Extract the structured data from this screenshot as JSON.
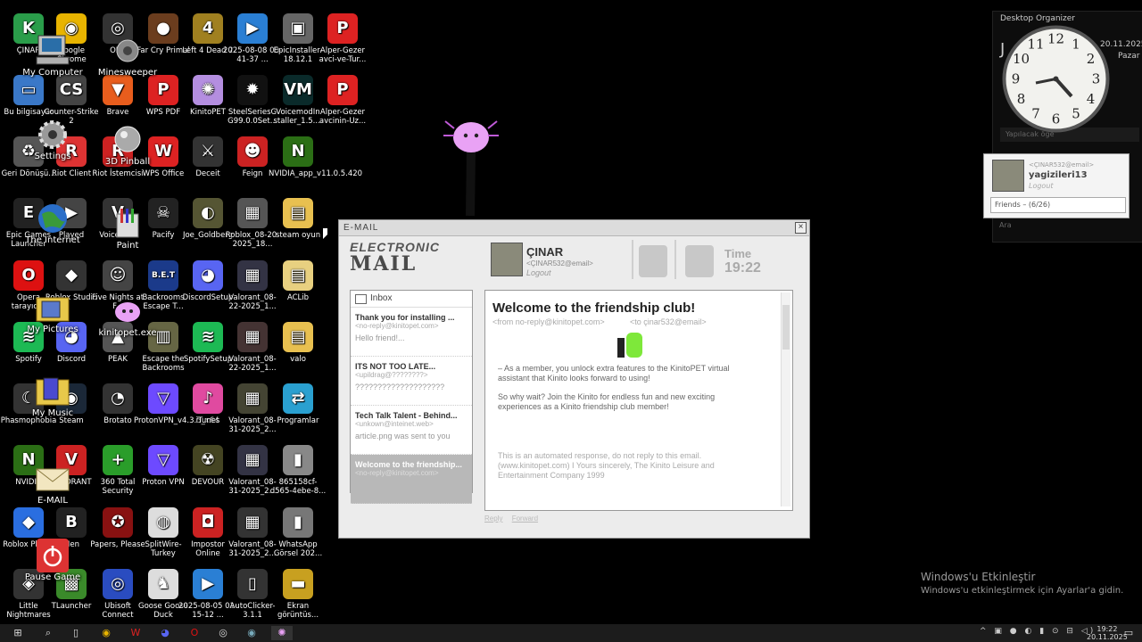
{
  "desktop": {
    "icons": [
      {
        "label": "ÇINAR",
        "glyph": "K",
        "color": "#2a9d4a"
      },
      {
        "label": "Google Chrome",
        "glyph": "◉",
        "color": "#e8b400"
      },
      {
        "label": "OBS",
        "glyph": "◎",
        "color": "#333"
      },
      {
        "label": "Far Cry Primal",
        "glyph": "●",
        "color": "#6b3d1e"
      },
      {
        "label": "Left 4 Dead 2",
        "glyph": "4",
        "color": "#a08020"
      },
      {
        "label": "2025-08-08 00-41-37 ...",
        "glyph": "▶",
        "color": "#2a7fd4"
      },
      {
        "label": "EpicInstaller-18.12.1",
        "glyph": "▣",
        "color": "#666"
      },
      {
        "label": "Alper-Gezer avci-ve-Tur...",
        "glyph": "P",
        "color": "#d22"
      },
      {
        "label": "Bu bilgisayar",
        "glyph": "▭",
        "color": "#3a78c8"
      },
      {
        "label": "Counter-Strike 2",
        "glyph": "CS",
        "color": "#444"
      },
      {
        "label": "Brave",
        "glyph": "▼",
        "color": "#e85d1d"
      },
      {
        "label": "WPS PDF",
        "glyph": "P",
        "color": "#d22"
      },
      {
        "label": "KinitoPET",
        "glyph": "✺",
        "color": "#b48ee0"
      },
      {
        "label": "SteelSeriesG G99.0.0Set...",
        "glyph": "✹",
        "color": "#111"
      },
      {
        "label": "VoicemodIn staller_1.5....",
        "glyph": "VM",
        "color": "#0a2a2a"
      },
      {
        "label": "Alper-Gezer avcinin-Uz...",
        "glyph": "P",
        "color": "#d22"
      },
      {
        "label": "Geri Dönüşü...",
        "glyph": "♻",
        "color": "#555"
      },
      {
        "label": "Riot Client",
        "glyph": "R",
        "color": "#d33"
      },
      {
        "label": "Riot İstemcisi",
        "glyph": "R",
        "color": "#c22"
      },
      {
        "label": "WPS Office",
        "glyph": "W",
        "color": "#d22"
      },
      {
        "label": "Deceit",
        "glyph": "⚔",
        "color": "#333"
      },
      {
        "label": "Feign",
        "glyph": "☻",
        "color": "#c22"
      },
      {
        "label": "NVIDIA_app_v11.0.5.420",
        "glyph": "N",
        "color": "#2b6e15"
      },
      {
        "label": "",
        "glyph": "",
        "color": "#000"
      },
      {
        "label": "Epic Games Launcher",
        "glyph": "E",
        "color": "#222"
      },
      {
        "label": "Played",
        "glyph": "▶",
        "color": "#444"
      },
      {
        "label": "Voicemod",
        "glyph": "V",
        "color": "#333"
      },
      {
        "label": "Pacify",
        "glyph": "☠",
        "color": "#222"
      },
      {
        "label": "Joe_Goldberg",
        "glyph": "◐",
        "color": "#553"
      },
      {
        "label": "Roblox_08-20-2025_18...",
        "glyph": "▦",
        "color": "#555"
      },
      {
        "label": "steam oyun",
        "glyph": "▤",
        "color": "#e8c050"
      },
      {
        "label": "",
        "glyph": "",
        "color": "#000"
      },
      {
        "label": "Opera tarayıcısı",
        "glyph": "O",
        "color": "#d11"
      },
      {
        "label": "Roblox Studio",
        "glyph": "◆",
        "color": "#333"
      },
      {
        "label": "Five Nights at F...",
        "glyph": "☺",
        "color": "#444"
      },
      {
        "label": "Backrooms Escape T...",
        "glyph": "B.E.T",
        "color": "#1b3a8a"
      },
      {
        "label": "DiscordSetup",
        "glyph": "◕",
        "color": "#5865f2"
      },
      {
        "label": "Valorant_08-22-2025_1...",
        "glyph": "▦",
        "color": "#334"
      },
      {
        "label": "ACLib",
        "glyph": "▤",
        "color": "#e8d080"
      },
      {
        "label": "",
        "glyph": "",
        "color": "#000"
      },
      {
        "label": "Spotify",
        "glyph": "≋",
        "color": "#1db954"
      },
      {
        "label": "Discord",
        "glyph": "◕",
        "color": "#5865f2"
      },
      {
        "label": "PEAK",
        "glyph": "▲",
        "color": "#555"
      },
      {
        "label": "Escape the Backrooms",
        "glyph": "▥",
        "color": "#664"
      },
      {
        "label": "SpotifySetup",
        "glyph": "≋",
        "color": "#1db954"
      },
      {
        "label": "Valorant_08-22-2025_1...",
        "glyph": "▦",
        "color": "#433"
      },
      {
        "label": "valo",
        "glyph": "▤",
        "color": "#e8c050"
      },
      {
        "label": "",
        "glyph": "",
        "color": "#000"
      },
      {
        "label": "Phasmophobia",
        "glyph": "☾",
        "color": "#333"
      },
      {
        "label": "Steam",
        "glyph": "◉",
        "color": "#1b2838"
      },
      {
        "label": "Brotato",
        "glyph": "◔",
        "color": "#333"
      },
      {
        "label": "ProtonVPN_v4.3.5_x64",
        "glyph": "▽",
        "color": "#6d4aff"
      },
      {
        "label": "iTunes",
        "glyph": "♪",
        "color": "#e04aa0"
      },
      {
        "label": "Valorant_08-31-2025_2...",
        "glyph": "▦",
        "color": "#443"
      },
      {
        "label": "Programlar",
        "glyph": "⇄",
        "color": "#2aa0d0"
      },
      {
        "label": "",
        "glyph": "",
        "color": "#000"
      },
      {
        "label": "NVIDIA",
        "glyph": "N",
        "color": "#2b6e15"
      },
      {
        "label": "VALORANT",
        "glyph": "V",
        "color": "#c22"
      },
      {
        "label": "360 Total Security",
        "glyph": "+",
        "color": "#2a9d2a"
      },
      {
        "label": "Proton VPN",
        "glyph": "▽",
        "color": "#6d4aff"
      },
      {
        "label": "DEVOUR",
        "glyph": "☢",
        "color": "#442"
      },
      {
        "label": "Valorant_08-31-2025_2...",
        "glyph": "▦",
        "color": "#334"
      },
      {
        "label": "865158cf-d565-4ebe-8...",
        "glyph": "▮",
        "color": "#888"
      },
      {
        "label": "",
        "glyph": "",
        "color": "#000"
      },
      {
        "label": "Roblox Player",
        "glyph": "◆",
        "color": "#2a6ee0"
      },
      {
        "label": "Men",
        "glyph": "B",
        "color": "#222"
      },
      {
        "label": "Papers, Please",
        "glyph": "✪",
        "color": "#811"
      },
      {
        "label": "SplitWire-Turkey",
        "glyph": "◍",
        "color": "#ddd"
      },
      {
        "label": "Impostor Online",
        "glyph": "◘",
        "color": "#c22"
      },
      {
        "label": "Valorant_08-31-2025_2...",
        "glyph": "▦",
        "color": "#333"
      },
      {
        "label": "WhatsApp Görsel 202...",
        "glyph": "▮",
        "color": "#777"
      },
      {
        "label": "",
        "glyph": "",
        "color": "#000"
      },
      {
        "label": "Little Nightmares",
        "glyph": "◈",
        "color": "#333"
      },
      {
        "label": "TLauncher",
        "glyph": "▩",
        "color": "#3a8a2a"
      },
      {
        "label": "Ubisoft Connect",
        "glyph": "◎",
        "color": "#2a4cc0"
      },
      {
        "label": "Goose Goose Duck",
        "glyph": "♞",
        "color": "#ddd"
      },
      {
        "label": "2025-08-05 01-15-12 ...",
        "glyph": "▶",
        "color": "#2a7fd4"
      },
      {
        "label": "AutoClicker-3.1.1",
        "glyph": "▯",
        "color": "#333"
      },
      {
        "label": "Ekran görüntüs...",
        "glyph": "▬",
        "color": "#c8a020"
      },
      {
        "label": "",
        "glyph": "",
        "color": "#000"
      }
    ]
  },
  "kinito_icons": [
    {
      "label": "My Computer"
    },
    {
      "label": "Minesweeper"
    },
    {
      "label": "Settings"
    },
    {
      "label": "3D Pinball"
    },
    {
      "label": "The Internet"
    },
    {
      "label": "Paint"
    },
    {
      "label": "My Pictures"
    },
    {
      "label": "kinitopet.exe"
    },
    {
      "label": "My Music"
    },
    {
      "label": "E-MAIL"
    },
    {
      "label": "Pause Game"
    }
  ],
  "email": {
    "title": "E-MAIL",
    "logo_line1": "ELECTRONIC",
    "logo_line2": "MAIL",
    "user_name": "ÇINAR",
    "user_email": "<ÇINAR532@email>",
    "logout": "Logout",
    "time_label": "Time",
    "time_value": "19:22",
    "inbox_label": "Inbox",
    "messages": [
      {
        "title": "Thank you for installing ...",
        "from": "<no-reply@kinitopet.com>",
        "preview": "Hello friend!..."
      },
      {
        "title": "ITS NOT TOO LATE...",
        "from": "<upildrag@????????>",
        "preview": "????????????????????"
      },
      {
        "title": "Tech Talk Talent - Behind...",
        "from": "<unkown@inteinet.web>",
        "preview": "article.png was sent to you"
      },
      {
        "title": "Welcome to the friendship...",
        "from": "<no-reply@kinitopet.com>",
        "preview": ""
      }
    ],
    "open": {
      "title": "Welcome to the friendship club!",
      "from": "<from no-reply@kinitopet.com>",
      "to": "<to çinar532@email>",
      "p1": "– As a member, you unlock extra features to the KinitoPET virtual assistant that Kinito looks forward to using!",
      "p2": "So why wait? Join the Kinito for endless fun and new exciting experiences as a Kinito friendship club member!",
      "p3": "This is an automated response, do not reply to this email. (www.kinitopet.com) I Yours sincerely, The Kinito Leisure and Entertainment Company 1999"
    },
    "reply": "Reply",
    "forward": "Forward"
  },
  "organizer": {
    "title": "Desktop Organizer",
    "date": "20.11.2025",
    "day": "Pazar",
    "big_letter": "J",
    "todo": "Yapılacak öğe"
  },
  "friend_card": {
    "email": "<ÇINAR532@email>",
    "name": "yagizileri13",
    "logout": "Logout",
    "friends": "Friends – (6/26)"
  },
  "search_label": "Ara",
  "activation": {
    "title": "Windows'u Etkinleştir",
    "subtitle": "Windows'u etkinleştirmek için Ayarlar'a gidin."
  },
  "taskbar": {
    "time": "19:22",
    "date": "20.11.2025"
  }
}
